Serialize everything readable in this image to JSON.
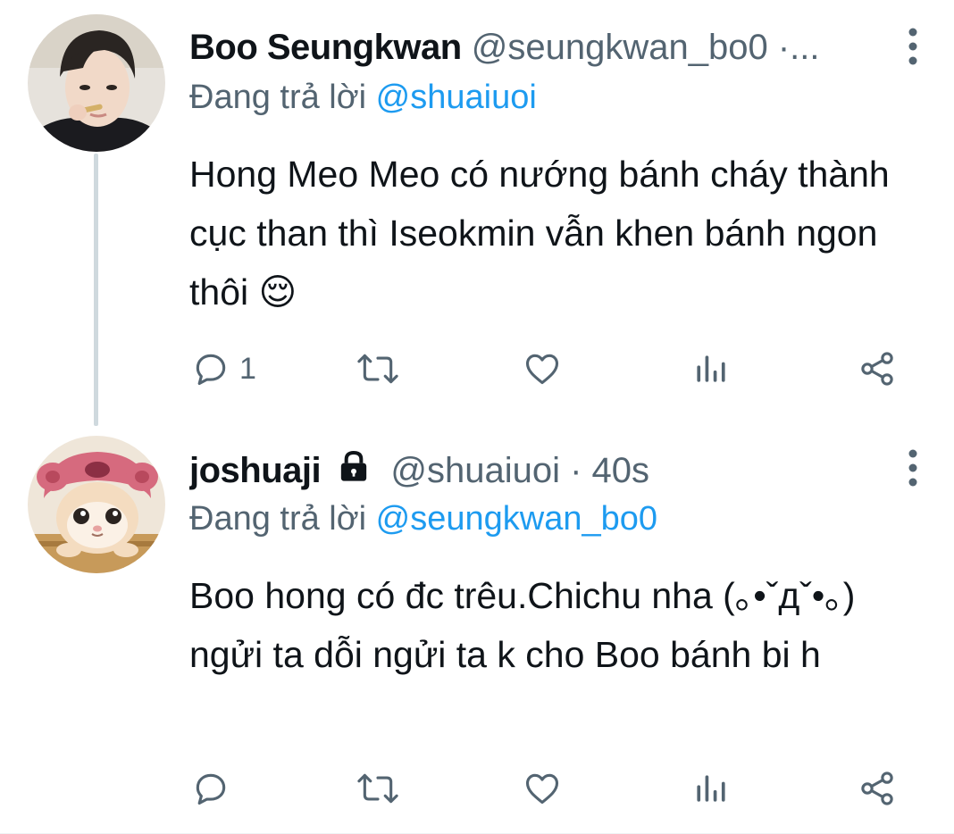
{
  "tweets": [
    {
      "display_name": "Boo Seungkwan",
      "handle_time": "@seungkwan_bo0 ·...",
      "replying_label": "Đang trả lời",
      "replying_to": "@shuaiuoi",
      "text": "Hong Meo Meo có nướng bánh cháy thành cục than thì Iseokmin vẫn khen bánh ngon thôi 😌",
      "reply_count": "1",
      "icons": [
        "reply-icon",
        "retweet-icon",
        "like-icon",
        "views-icon",
        "share-icon",
        "more-icon"
      ]
    },
    {
      "display_name": "joshuaji",
      "handle_time": "@shuaiuoi · 40s",
      "replying_label": "Đang trả lời",
      "replying_to": "@seungkwan_bo0",
      "text": "Boo hong có đc trêu.Chichu nha (｡•ˇдˇ•｡) ngửi ta dỗi ngửi ta k cho Boo bánh bi h",
      "reply_count": "",
      "icons": [
        "lock-icon",
        "reply-icon",
        "retweet-icon",
        "like-icon",
        "views-icon",
        "share-icon",
        "more-icon"
      ]
    }
  ],
  "colors": {
    "text": "#0f1419",
    "secondary": "#536471",
    "accent": "#1d9bf0",
    "thread_line": "#cfd9de"
  }
}
